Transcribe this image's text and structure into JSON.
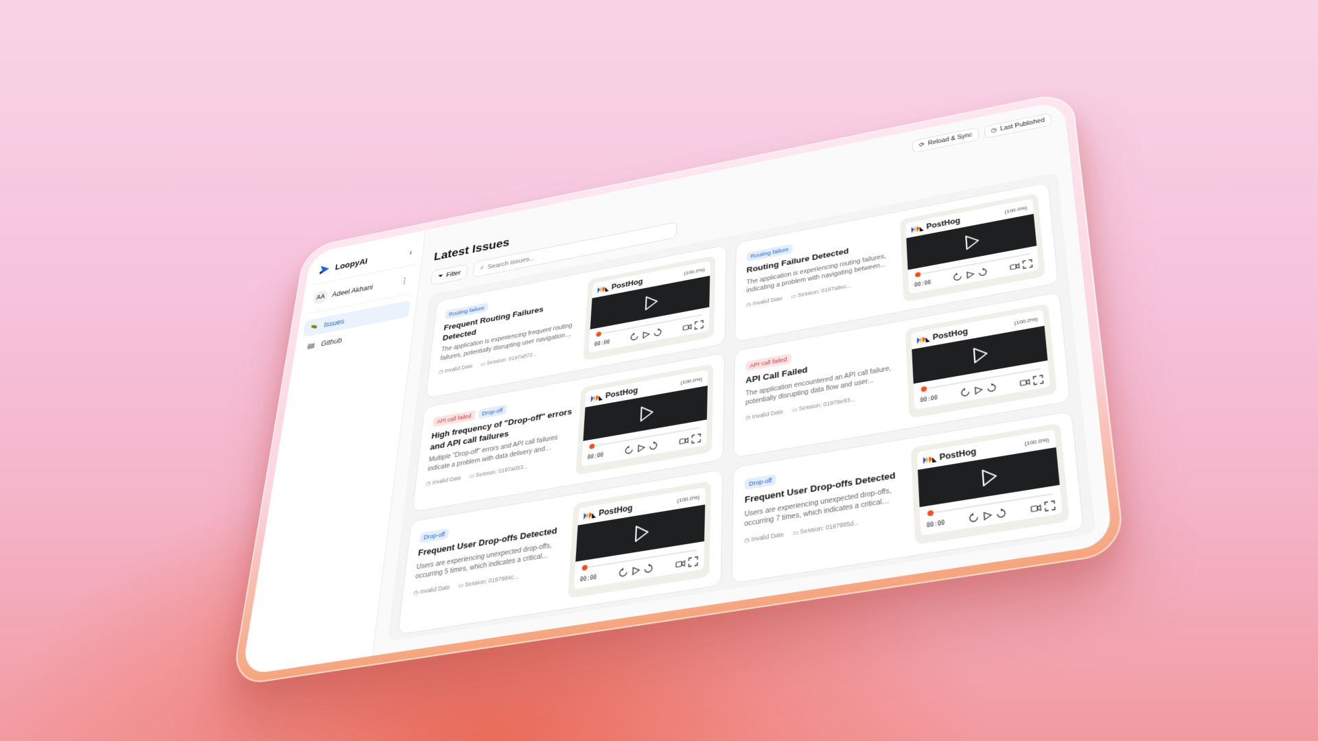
{
  "app": {
    "name": "LoopyAI"
  },
  "user": {
    "initials": "AA",
    "name": "Adeel Akhani"
  },
  "nav": [
    {
      "label": "Issues",
      "active": true
    },
    {
      "label": "Github",
      "active": false
    }
  ],
  "topbar": {
    "reload_label": "Reload & Sync",
    "published_label": "Last Published"
  },
  "page": {
    "title": "Latest Issues"
  },
  "toolbar": {
    "filter_label": "Filter",
    "search_placeholder": "Search issues..."
  },
  "player": {
    "brand": "PostHog",
    "percent": "(100.0%)",
    "time": "00:00"
  },
  "issues": [
    {
      "tags": [
        {
          "label": "Routing failure",
          "color": "blue"
        }
      ],
      "title": "Frequent Routing Failures Detected",
      "desc": "The application is experiencing frequent routing failures, potentially disrupting user navigation and...",
      "date": "Invalid Date",
      "session": "Session: 0197a872..."
    },
    {
      "tags": [
        {
          "label": "Routing failure",
          "color": "blue"
        }
      ],
      "title": "Routing Failure Detected",
      "desc": "The application is experiencing routing failures, indicating a problem with navigating between...",
      "date": "Invalid Date",
      "session": "Session: 0197a8ec..."
    },
    {
      "tags": [
        {
          "label": "API call failed",
          "color": "red"
        },
        {
          "label": "Drop-off",
          "color": "blue"
        }
      ],
      "title": "High frequency of \"Drop-off\" errors and API call failures",
      "desc": "Multiple \"Drop-off\" errors and API call failures indicate a problem with data delivery and backen...",
      "date": "Invalid Date",
      "session": "Session: 0197a053..."
    },
    {
      "tags": [
        {
          "label": "API call failed",
          "color": "red"
        }
      ],
      "title": "API Call Failed",
      "desc": "The application encountered an API call failure, potentially disrupting data flow and user...",
      "date": "Invalid Date",
      "session": "Session: 01979e93..."
    },
    {
      "tags": [
        {
          "label": "Drop-off",
          "color": "blue"
        }
      ],
      "title": "Frequent User Drop-offs Detected",
      "desc": "Users are experiencing unexpected drop-offs, occurring 5 times, which indicates a critical...",
      "date": "Invalid Date",
      "session": "Session: 0197984c..."
    },
    {
      "tags": [
        {
          "label": "Drop-off",
          "color": "blue"
        }
      ],
      "title": "Frequent User Drop-offs Detected",
      "desc": "Users are experiencing unexpected drop-offs, occurring 7 times, which indicates a critical issue...",
      "date": "Invalid Date",
      "session": "Session: 0197985d..."
    }
  ],
  "colors": {
    "accent": "#1b5fd1",
    "progress": "#f0521b",
    "video_bg": "#1d1f21"
  }
}
